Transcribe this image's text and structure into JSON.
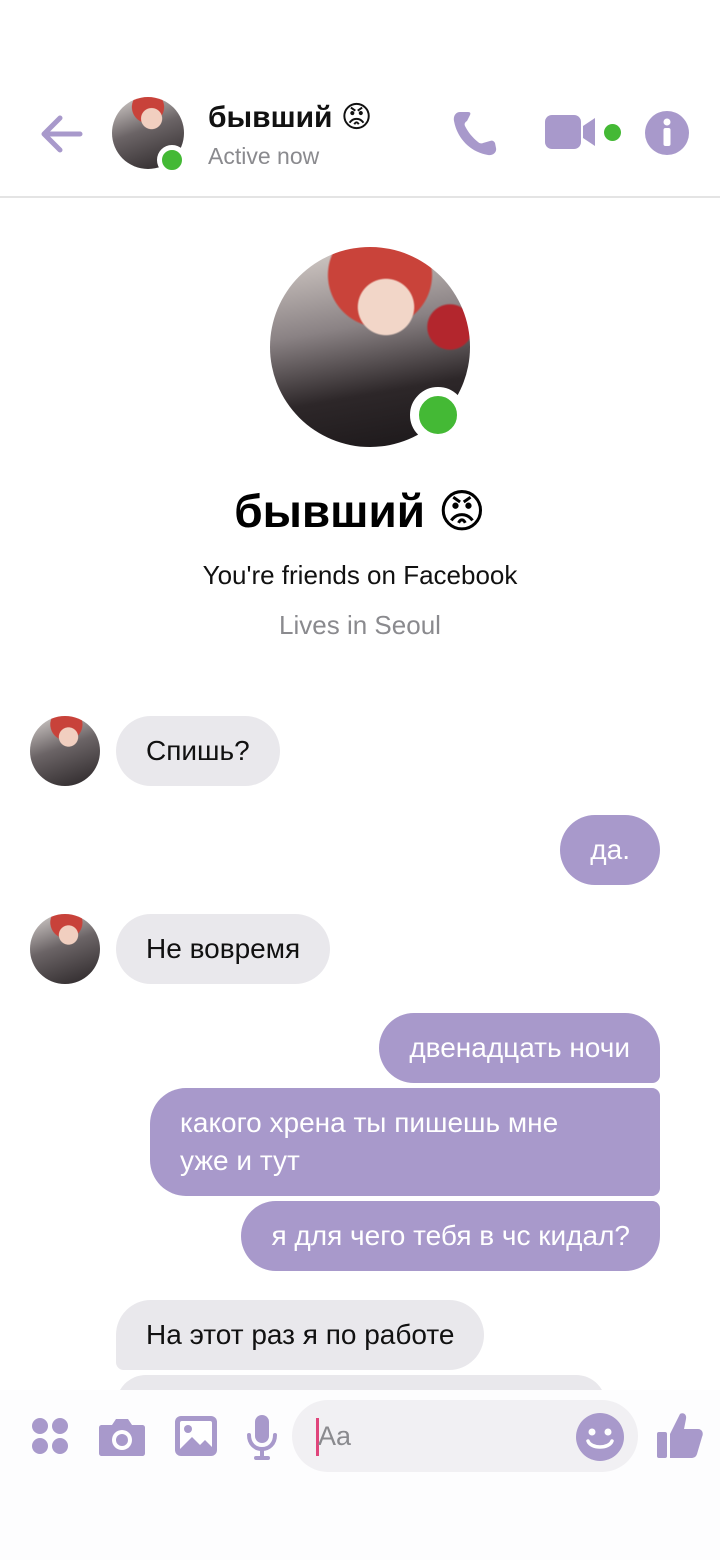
{
  "header": {
    "contact_name": "бывший 😡",
    "status": "Active now",
    "accent_color": "#a899cb",
    "online_color": "#44b935",
    "icons": [
      "back-arrow-icon",
      "phone-icon",
      "video-camera-icon",
      "info-icon"
    ]
  },
  "profile": {
    "name": "бывший 😡",
    "friendship": "You're friends on Facebook",
    "location": "Lives in Seoul"
  },
  "messages": [
    {
      "from": "them",
      "text": "Спишь?"
    },
    {
      "from": "me",
      "text": "да."
    },
    {
      "from": "them",
      "text": "Не вовремя"
    },
    {
      "from": "me",
      "text": "двенадцать ночи"
    },
    {
      "from": "me",
      "text": "какого хрена ты пишешь мне",
      "text2": "уже и тут"
    },
    {
      "from": "me",
      "text": "я для чего тебя в чс кидал?"
    },
    {
      "from": "them",
      "text": "На этот раз я по работе"
    }
  ],
  "composer": {
    "placeholder": "Aa",
    "icons": [
      "apps-icon",
      "camera-icon",
      "gallery-icon",
      "microphone-icon",
      "emoji-icon",
      "thumbs-up-icon"
    ]
  }
}
